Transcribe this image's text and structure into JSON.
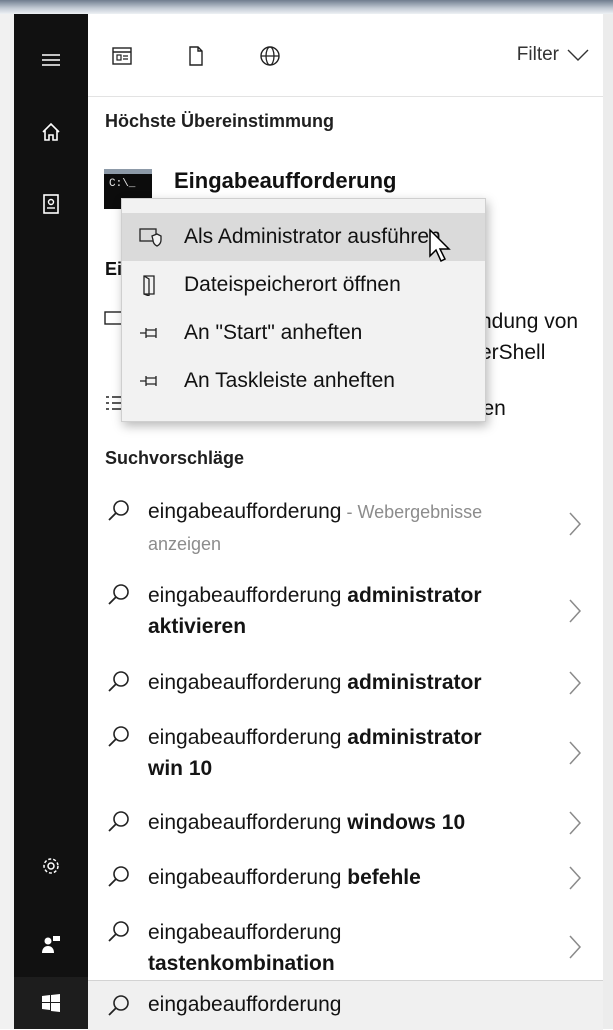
{
  "rail": {
    "items": [
      {
        "name": "hamburger-icon"
      },
      {
        "name": "home-icon"
      },
      {
        "name": "notebook-icon"
      },
      {
        "name": "settings-gear-icon"
      },
      {
        "name": "feedback-icon"
      },
      {
        "name": "windows-start-icon"
      }
    ]
  },
  "toolbar": {
    "icons": [
      "apps-icon",
      "documents-icon",
      "web-globe-icon"
    ],
    "filter_label": "Filter"
  },
  "best_match": {
    "heading": "Höchste Übereinstimmung",
    "app_name": "Eingabeaufforderung",
    "icon_text": "C:\\_"
  },
  "partially_hidden": {
    "apps_heading_fragment": "Ei",
    "row1_line1": "ndung von",
    "row1_line2": "erShell",
    "row2": "lten"
  },
  "context_menu": {
    "items": [
      {
        "label": "Als Administrator ausführen",
        "icon": "shield-run-icon",
        "highlighted": true
      },
      {
        "label": "Dateispeicherort öffnen",
        "icon": "open-file-location-icon",
        "highlighted": false
      },
      {
        "label": "An \"Start\" anheften",
        "icon": "pin-icon",
        "highlighted": false
      },
      {
        "label": "An Taskleiste anheften",
        "icon": "pin-icon",
        "highlighted": false
      }
    ]
  },
  "suggestions": {
    "heading": "Suchvorschläge",
    "items": [
      {
        "normal": "eingabeaufforderung",
        "bold": "",
        "suffix": " - Webergebnisse",
        "sub": "anzeigen"
      },
      {
        "normal": "eingabeaufforderung ",
        "bold": "administrator",
        "line2": "aktivieren"
      },
      {
        "normal": "eingabeaufforderung ",
        "bold": "administrator"
      },
      {
        "normal": "eingabeaufforderung ",
        "bold": "administrator",
        "line2": "win 10"
      },
      {
        "normal": "eingabeaufforderung ",
        "bold": "windows 10"
      },
      {
        "normal": "eingabeaufforderung ",
        "bold": "befehle"
      },
      {
        "normal": "eingabeaufforderung",
        "bold": "",
        "line2": "tastenkombination"
      }
    ]
  },
  "search": {
    "value": "eingabeaufforderung"
  }
}
